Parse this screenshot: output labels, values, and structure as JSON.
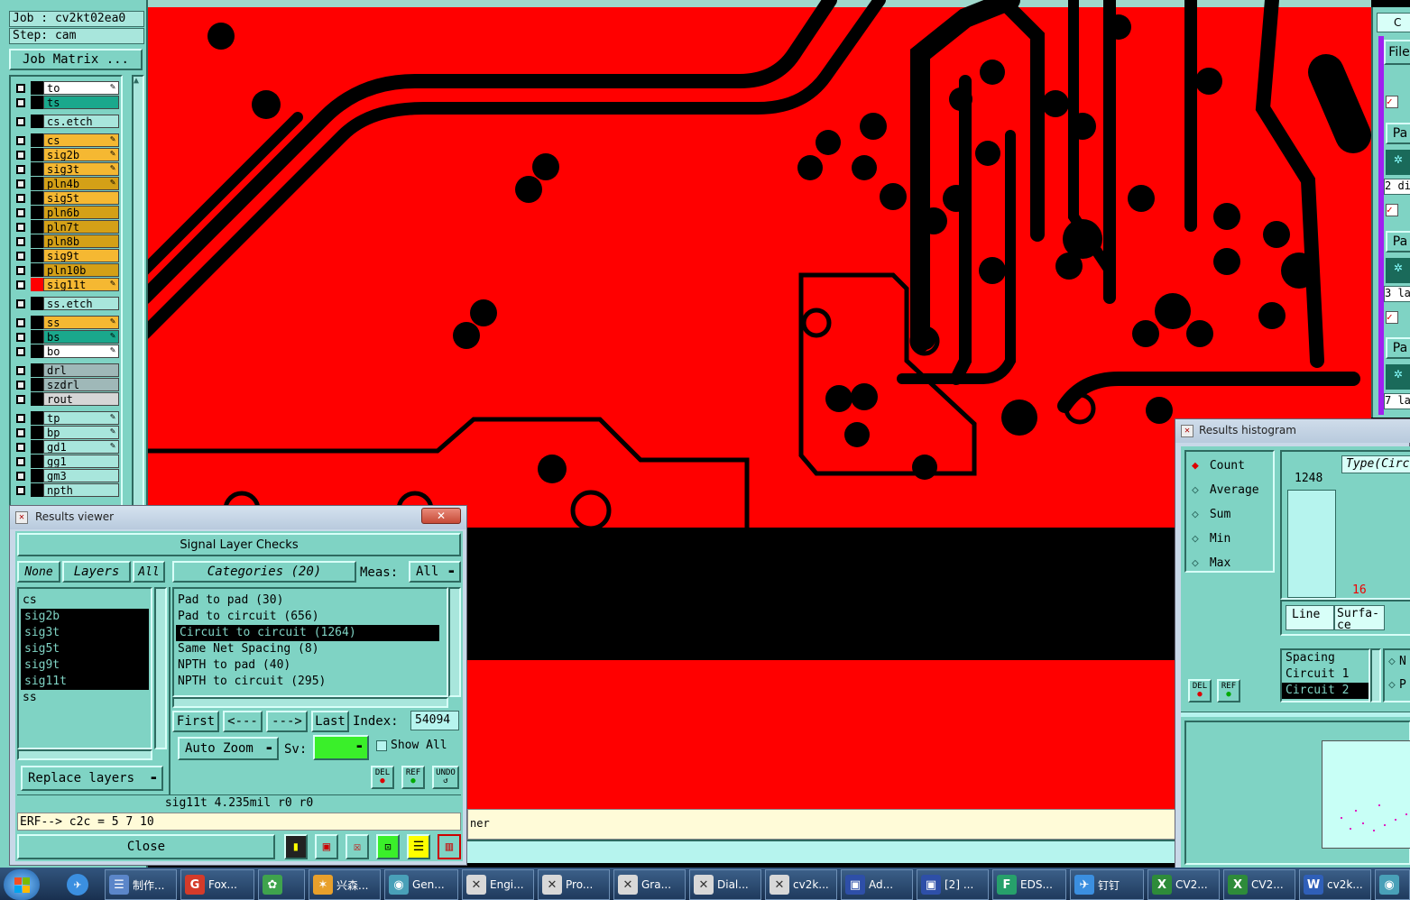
{
  "job_panel": {
    "job_label": "Job : cv2kt02ea0",
    "step_label": "Step: cam",
    "job_matrix_button": "Job Matrix ..."
  },
  "layers": [
    {
      "name": "to",
      "color": "#ffffff",
      "edit": true
    },
    {
      "name": "ts",
      "color": "#1aa88c",
      "edit": false
    },
    {
      "name": "cs.etch",
      "color": "#a8e6dc",
      "edit": false
    },
    {
      "name": "cs",
      "color": "#f5b832",
      "edit": true
    },
    {
      "name": "sig2b",
      "color": "#f5b832",
      "edit": true
    },
    {
      "name": "sig3t",
      "color": "#f5b832",
      "edit": true
    },
    {
      "name": "pln4b",
      "color": "#d4a017",
      "edit": true
    },
    {
      "name": "sig5t",
      "color": "#f5b832",
      "edit": false
    },
    {
      "name": "pln6b",
      "color": "#d4a017",
      "edit": false
    },
    {
      "name": "pln7t",
      "color": "#d4a017",
      "edit": false
    },
    {
      "name": "pln8b",
      "color": "#d4a017",
      "edit": false
    },
    {
      "name": "sig9t",
      "color": "#f5b832",
      "edit": false
    },
    {
      "name": "pln10b",
      "color": "#d4a017",
      "edit": false
    },
    {
      "name": "sig11t",
      "color": "#f5b832",
      "edit": true,
      "active": true
    },
    {
      "name": "ss.etch",
      "color": "#a8e6dc",
      "edit": false
    },
    {
      "name": "ss",
      "color": "#f5b832",
      "edit": true
    },
    {
      "name": "bs",
      "color": "#1aa88c",
      "edit": true
    },
    {
      "name": "bo",
      "color": "#ffffff",
      "edit": true
    },
    {
      "name": "drl",
      "color": "#9fb8b8",
      "edit": false
    },
    {
      "name": "szdrl",
      "color": "#9fb8b8",
      "edit": false
    },
    {
      "name": "rout",
      "color": "#d6d6d6",
      "edit": false
    },
    {
      "name": "tp",
      "color": "#a8e6dc",
      "edit": true
    },
    {
      "name": "bp",
      "color": "#a8e6dc",
      "edit": true
    },
    {
      "name": "gd1",
      "color": "#a8e6dc",
      "edit": true
    },
    {
      "name": "gg1",
      "color": "#a8e6dc",
      "edit": false
    },
    {
      "name": "gm3",
      "color": "#a8e6dc",
      "edit": false
    },
    {
      "name": "npth",
      "color": "#a8e6dc",
      "edit": false
    }
  ],
  "results_viewer": {
    "title": "Results viewer",
    "header": "Signal Layer Checks",
    "none_btn": "None",
    "layers_btn": "Layers",
    "all_btn": "All",
    "categories_btn": "Categories (20)",
    "meas_label": "Meas:",
    "meas_value": "All",
    "layer_items": [
      {
        "name": "cs",
        "selected": false
      },
      {
        "name": "sig2b",
        "selected": true
      },
      {
        "name": "sig3t",
        "selected": true
      },
      {
        "name": "sig5t",
        "selected": true
      },
      {
        "name": "sig9t",
        "selected": true
      },
      {
        "name": "sig11t",
        "selected": true
      },
      {
        "name": "ss",
        "selected": false
      }
    ],
    "category_items": [
      {
        "name": "Pad to pad (30)",
        "selected": false
      },
      {
        "name": "Pad to circuit (656)",
        "selected": false
      },
      {
        "name": "Circuit to circuit (1264)",
        "selected": true
      },
      {
        "name": "Same Net Spacing (8)",
        "selected": false
      },
      {
        "name": "NPTH to pad (40)",
        "selected": false
      },
      {
        "name": "NPTH to circuit (295)",
        "selected": false
      }
    ],
    "first_btn": "First",
    "prev_btn": "<---",
    "next_btn": "--->",
    "last_btn": "Last",
    "index_label": "Index:",
    "index_value": "54094",
    "auto_zoom": "Auto Zoom",
    "sv_label": "Sv:",
    "show_all": "Show All",
    "replace_layers": "Replace layers",
    "del_label": "DEL",
    "ref_label": "REF",
    "undo_label": "UNDO",
    "status_line": "sig11t 4.235mil  r0  r0",
    "erf_line": "ERF--> c2c = 5 7 10",
    "close_btn": "Close"
  },
  "message_fragment": "ner",
  "histogram": {
    "title": "Results histogram",
    "radios": [
      {
        "label": "Count",
        "checked": true
      },
      {
        "label": "Average",
        "checked": false
      },
      {
        "label": "Sum",
        "checked": false
      },
      {
        "label": "Min",
        "checked": false
      },
      {
        "label": "Max",
        "checked": false
      }
    ],
    "type_label": "Type(Circ",
    "max_value": "1248",
    "bar2_value": "16",
    "line_btn": "Line",
    "surface_btn": "Surfa-ce",
    "spacing_items": [
      {
        "name": "Spacing",
        "selected": false
      },
      {
        "name": "Circuit 1",
        "selected": false
      },
      {
        "name": "Circuit 2",
        "selected": true
      }
    ],
    "opt_n": "N",
    "opt_p": "P",
    "del_label": "DEL",
    "ref_label": "REF"
  },
  "right_panel": {
    "tab_label": "C",
    "file_label": "File",
    "pa_labels": [
      "Pa",
      "Pa",
      "Pa"
    ],
    "row_texts": [
      "2 di",
      "3 la",
      "7 la"
    ]
  },
  "taskbar": [
    {
      "label": "制作...",
      "icon": "doc-icon",
      "color": "#5b86c9"
    },
    {
      "label": "Fox...",
      "icon": "foxit-icon",
      "color": "#d43b2a"
    },
    {
      "label": "",
      "icon": "picasa-icon",
      "color": "#3fa34d"
    },
    {
      "label": "兴森...",
      "icon": "starfish-icon",
      "color": "#e8a02b"
    },
    {
      "label": "Gen...",
      "icon": "genesis-icon",
      "color": "#49a0b8"
    },
    {
      "label": "Engi...",
      "icon": "x-window-icon",
      "color": "#d8d8d8"
    },
    {
      "label": "Pro...",
      "icon": "x-window-icon",
      "color": "#d8d8d8"
    },
    {
      "label": "Gra...",
      "icon": "x-window-icon",
      "color": "#d8d8d8"
    },
    {
      "label": "Dial...",
      "icon": "x-window-icon",
      "color": "#d8d8d8"
    },
    {
      "label": "cv2k...",
      "icon": "x-window-icon",
      "color": "#d8d8d8"
    },
    {
      "label": "Ad...",
      "icon": "save-icon",
      "color": "#2e4fa8"
    },
    {
      "label": "[2] ...",
      "icon": "save-icon",
      "color": "#2e4fa8"
    },
    {
      "label": "EDS...",
      "icon": "eds-icon",
      "color": "#27a06b"
    },
    {
      "label": "钉钉",
      "icon": "dingtalk-icon",
      "color": "#3b8fe0"
    },
    {
      "label": "CV2...",
      "icon": "excel-icon",
      "color": "#2e8b3a"
    },
    {
      "label": "CV2...",
      "icon": "excel-icon",
      "color": "#2e8b3a"
    },
    {
      "label": "cv2k...",
      "icon": "word-icon",
      "color": "#2f5fb8"
    },
    {
      "label": "",
      "icon": "app-icon",
      "color": "#49a0b8"
    }
  ]
}
